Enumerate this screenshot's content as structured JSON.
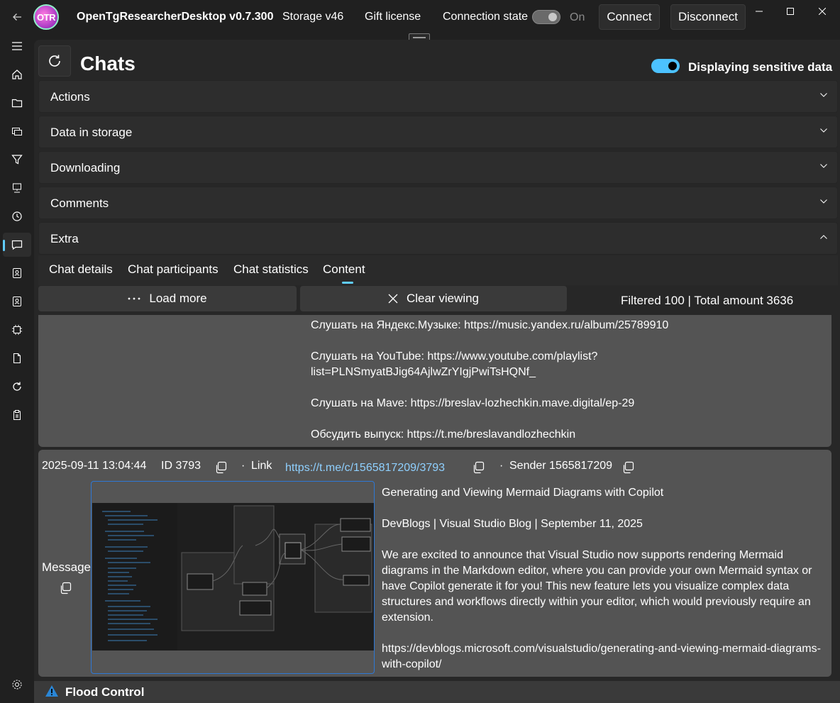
{
  "titlebar": {
    "logo_text": "OTR",
    "app_title": "OpenTgResearcherDesktop v0.7.300",
    "storage": "Storage v46",
    "gift": "Gift license",
    "connection_label": "Connection state",
    "connection_toggle_state": "On",
    "connect": "Connect",
    "disconnect": "Disconnect"
  },
  "rail": {
    "items": [
      "menu-icon",
      "home-icon",
      "folder-icon",
      "contacts-icon",
      "filter-icon",
      "computer-icon",
      "history-icon",
      "chat-icon",
      "user-card-icon",
      "user-badge-icon",
      "chip-icon",
      "document-icon",
      "sync-icon",
      "clipboard-icon",
      "settings-icon"
    ],
    "active": "chat-icon"
  },
  "page": {
    "title": "Chats",
    "sensitive_label": "Displaying sensitive data",
    "sensitive_on": true
  },
  "sections": [
    {
      "label": "Actions",
      "expanded": false
    },
    {
      "label": "Data in storage",
      "expanded": false
    },
    {
      "label": "Downloading",
      "expanded": false
    },
    {
      "label": "Comments",
      "expanded": false
    },
    {
      "label": "Extra",
      "expanded": true
    }
  ],
  "tabs": [
    "Chat details",
    "Chat participants",
    "Chat statistics",
    "Content"
  ],
  "active_tab": "Content",
  "toolbar": {
    "load_more": "Load more",
    "clear_viewing": "Clear viewing",
    "filtered": "Filtered 100 | Total amount 3636"
  },
  "messages": [
    {
      "text": "Слушать на Яндекс.Музыке: https://music.yandex.ru/album/25789910\n\nСлушать на YouTube: https://www.youtube.com/playlist?\nlist=PLNSmyatBJig64AjlwZrYIgjPwiTsHQNf_\n\nСлушать на Mave: https://breslav-lozhechkin.mave.digital/ep-29\n\nОбсудить выпуск: https://t.me/breslavandlozhechkin"
    },
    {
      "date": "2025-09-11 13:04:44",
      "id": "ID 3793",
      "link_label": "Link",
      "link": "https://t.me/c/1565817209/3793",
      "sender": "Sender 1565817209",
      "message_label": "Message",
      "text": "Generating and Viewing Mermaid Diagrams with Copilot\n\nDevBlogs | Visual Studio Blog | September 11, 2025\n\nWe are excited to announce that Visual Studio now supports rendering Mermaid diagrams in the Markdown editor, where you can provide your own Mermaid syntax or have Copilot generate it for you! This new feature lets you visualize complex data structures and workflows directly within your editor, which would previously require an extension.\n\nhttps://devblogs.microsoft.com/visualstudio/generating-and-viewing-mermaid-diagrams-with-copilot/"
    }
  ],
  "status": {
    "flood": "Flood Control"
  },
  "colors": {
    "accent": "#60cdff",
    "toggle_on": "#4cc2ff",
    "card": "#545454",
    "background": "#202020",
    "warning": "#2a86d6"
  }
}
